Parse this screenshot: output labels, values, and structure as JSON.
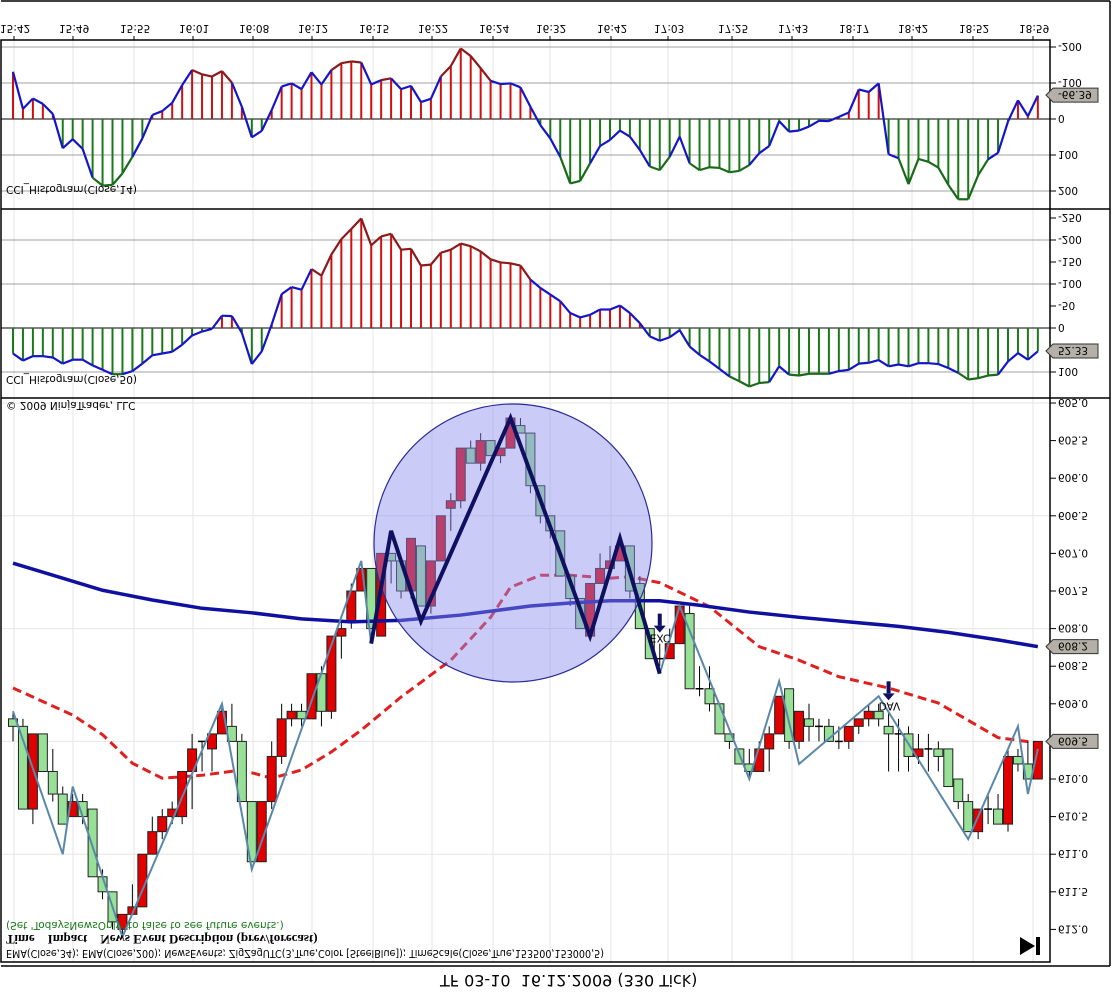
{
  "window": {
    "title": "TF 03-10  16.12.2009 (330 Tick)",
    "copyright": "© 2009 NinjaTrader, LLC",
    "go_to_end_icon": "skip-to-end-icon"
  },
  "time_axis": {
    "labels": [
      "15:42",
      "15:49",
      "15:55",
      "16:01",
      "16:08",
      "16:12",
      "16:15",
      "16:22",
      "16:24",
      "16:32",
      "16:42",
      "17:03",
      "17:25",
      "17:43",
      "18:17",
      "18:42",
      "18:52",
      "18:59"
    ]
  },
  "panels": {
    "cci14": {
      "label": "CCI_Histogram(Close,14)",
      "axis_labels": [
        "-200",
        "-100",
        "0",
        "100",
        "200"
      ],
      "current_value": "-66.39"
    },
    "cci50": {
      "label": "CCI_Histogram(Close,50)",
      "axis_labels": [
        "-250",
        "-200",
        "-150",
        "-100",
        "-50",
        "0",
        "100"
      ],
      "current_value": "52.33"
    },
    "price": {
      "axis_labels": [
        "605.0",
        "605.5",
        "606.0",
        "606.5",
        "607.0",
        "607.5",
        "608.0",
        "608.5",
        "609.0",
        "609.5",
        "610.0",
        "610.5",
        "611.0",
        "611.5",
        "612.0"
      ],
      "ema200_value": "608.2",
      "last_price": "609.5"
    }
  },
  "news": {
    "hint": "(Set 'TodaysNewsOnly' to false to see future events.)",
    "header": "Time    Impact    News Event Description (prev/forecast)",
    "markers": [
      {
        "label": "EXC",
        "bar": 65
      },
      {
        "label": "DAV",
        "bar": 88
      }
    ]
  },
  "indicators_text": "EMA(Close,34); EMA(Close,200); NewsEvents; ZigZagUTC(3,True,Color [SteelBlue]); TimeScale(Close,True,153500,153000,5)",
  "colors": {
    "up_candle": "#98e098",
    "down_candle": "#e00000",
    "ema200": "#1010a0",
    "ema34": "#e02020",
    "zigzag": "#5a88aa",
    "zigzag_pattern": "#101060",
    "cci_line": "#1515c8",
    "cci_positive_bar": "#1a7a1a",
    "cci_negative_bar": "#d01010",
    "highlight_circle": "#8c8cf0"
  },
  "chart_data": [
    {
      "type": "candlestick",
      "title": "",
      "ylim": [
        605.0,
        612.0
      ],
      "y_axis_inverted": true,
      "grid": true,
      "candles_ohlc": [
        [
          609.2,
          609.5,
          609.1,
          609.3
        ],
        [
          609.3,
          610.4,
          609.2,
          610.4
        ],
        [
          610.4,
          610.6,
          609.4,
          609.4
        ],
        [
          609.4,
          609.9,
          609.4,
          609.9
        ],
        [
          609.9,
          610.3,
          609.6,
          610.2
        ],
        [
          610.2,
          610.6,
          610.1,
          610.6
        ],
        [
          610.5,
          610.5,
          610.2,
          610.3
        ],
        [
          610.3,
          610.6,
          610.2,
          610.5
        ],
        [
          610.4,
          611.3,
          610.4,
          611.3
        ],
        [
          611.3,
          611.6,
          611.2,
          611.5
        ],
        [
          611.5,
          612.0,
          611.5,
          611.9
        ],
        [
          612.0,
          612.1,
          611.8,
          611.8
        ],
        [
          611.8,
          611.8,
          611.4,
          611.7
        ],
        [
          611.7,
          611.7,
          611.0,
          611.0
        ],
        [
          611.0,
          611.0,
          610.5,
          610.7
        ],
        [
          610.7,
          610.8,
          610.4,
          610.5
        ],
        [
          610.5,
          610.6,
          610.3,
          610.4
        ],
        [
          610.5,
          610.6,
          609.9,
          609.9
        ],
        [
          609.9,
          610.4,
          609.4,
          609.6
        ],
        [
          609.5,
          609.9,
          609.5,
          609.5
        ],
        [
          609.6,
          609.9,
          609.4,
          609.4
        ],
        [
          609.4,
          609.4,
          609.0,
          609.1
        ],
        [
          609.3,
          609.5,
          609.0,
          609.5
        ],
        [
          609.5,
          610.3,
          609.4,
          610.3
        ],
        [
          610.3,
          611.1,
          610.3,
          611.1
        ],
        [
          611.1,
          611.1,
          610.3,
          610.3
        ],
        [
          610.3,
          610.4,
          609.5,
          609.7
        ],
        [
          609.7,
          609.8,
          609.0,
          609.2
        ],
        [
          609.2,
          609.3,
          609.0,
          609.1
        ],
        [
          609.1,
          609.3,
          609.0,
          609.2
        ],
        [
          609.2,
          609.2,
          608.6,
          608.6
        ],
        [
          608.6,
          609.3,
          608.5,
          609.1
        ],
        [
          609.1,
          609.2,
          608.1,
          608.1
        ],
        [
          608.1,
          608.4,
          607.9,
          608.0
        ],
        [
          607.9,
          608.0,
          607.4,
          607.5
        ],
        [
          607.5,
          607.5,
          607.2,
          607.2
        ],
        [
          607.2,
          608.0,
          607.2,
          608.0
        ],
        [
          608.1,
          608.1,
          607.0,
          607.0
        ],
        [
          607.0,
          607.4,
          607.0,
          607.1
        ],
        [
          607.1,
          607.6,
          607.1,
          607.5
        ],
        [
          607.5,
          607.6,
          606.8,
          606.8
        ],
        [
          606.9,
          607.7,
          606.9,
          607.7
        ],
        [
          607.7,
          607.8,
          607.1,
          607.1
        ],
        [
          607.1,
          607.1,
          606.5,
          606.5
        ],
        [
          606.4,
          606.7,
          606.2,
          606.3
        ],
        [
          606.3,
          606.4,
          605.6,
          605.6
        ],
        [
          605.6,
          605.8,
          605.5,
          605.8
        ],
        [
          605.8,
          605.9,
          605.4,
          605.5
        ],
        [
          605.5,
          605.7,
          605.5,
          605.7
        ],
        [
          605.7,
          605.8,
          605.6,
          605.6
        ],
        [
          605.6,
          605.6,
          605.2,
          605.2
        ],
        [
          605.3,
          605.4,
          605.2,
          605.4
        ],
        [
          605.4,
          606.2,
          605.4,
          606.1
        ],
        [
          606.1,
          606.6,
          606.1,
          606.5
        ],
        [
          606.5,
          606.8,
          606.5,
          606.7
        ],
        [
          606.7,
          607.3,
          606.7,
          607.3
        ],
        [
          607.3,
          607.7,
          607.3,
          607.6
        ],
        [
          607.6,
          608.0,
          607.6,
          608.0
        ],
        [
          608.1,
          608.1,
          607.4,
          607.4
        ],
        [
          607.4,
          607.4,
          607.0,
          607.2
        ],
        [
          607.2,
          607.2,
          606.9,
          607.1
        ],
        [
          607.1,
          607.1,
          606.9,
          606.9
        ],
        [
          606.9,
          607.6,
          606.9,
          607.5
        ],
        [
          607.4,
          608.0,
          607.3,
          608.0
        ],
        [
          608.0,
          608.4,
          608.0,
          608.4
        ],
        [
          608.4,
          608.5,
          608.2,
          608.4
        ],
        [
          608.4,
          608.4,
          608.0,
          608.2
        ],
        [
          608.2,
          608.2,
          607.7,
          607.7
        ],
        [
          607.8,
          608.8,
          607.7,
          608.8
        ],
        [
          608.8,
          608.9,
          608.5,
          608.8
        ],
        [
          608.8,
          609.1,
          608.5,
          609.0
        ],
        [
          609.0,
          609.4,
          609.0,
          609.4
        ],
        [
          609.4,
          609.6,
          609.4,
          609.5
        ],
        [
          609.6,
          609.8,
          609.6,
          609.8
        ],
        [
          609.8,
          610.0,
          609.6,
          609.9
        ],
        [
          609.9,
          609.9,
          609.5,
          609.6
        ],
        [
          609.6,
          609.9,
          609.3,
          609.4
        ],
        [
          609.4,
          609.4,
          608.9,
          608.9
        ],
        [
          608.8,
          609.6,
          608.8,
          609.5
        ],
        [
          609.5,
          609.6,
          609.1,
          609.1
        ],
        [
          609.2,
          609.5,
          609.0,
          609.3
        ],
        [
          609.3,
          609.5,
          609.2,
          609.3
        ],
        [
          609.3,
          609.5,
          609.2,
          609.5
        ],
        [
          609.5,
          609.6,
          609.3,
          609.5
        ],
        [
          609.5,
          609.6,
          609.3,
          609.3
        ],
        [
          609.3,
          609.4,
          609.2,
          609.2
        ],
        [
          609.2,
          609.3,
          609.0,
          609.1
        ],
        [
          609.1,
          609.3,
          609.0,
          609.2
        ],
        [
          609.3,
          609.9,
          609.1,
          609.4
        ],
        [
          609.4,
          609.9,
          609.2,
          609.4
        ],
        [
          609.4,
          609.9,
          609.3,
          609.7
        ],
        [
          609.7,
          609.8,
          609.4,
          609.6
        ],
        [
          609.6,
          609.9,
          609.4,
          609.6
        ],
        [
          609.6,
          609.9,
          609.5,
          609.7
        ],
        [
          609.6,
          610.1,
          609.6,
          610.1
        ],
        [
          610.0,
          610.4,
          610.0,
          610.3
        ],
        [
          610.3,
          610.7,
          610.2,
          610.7
        ],
        [
          610.7,
          610.8,
          610.4,
          610.4
        ],
        [
          610.4,
          610.6,
          610.2,
          610.4
        ],
        [
          610.4,
          610.6,
          610.2,
          610.6
        ],
        [
          610.6,
          610.7,
          609.6,
          609.7
        ],
        [
          609.7,
          609.9,
          609.6,
          609.8
        ],
        [
          609.8,
          610.0,
          609.5,
          610.0
        ],
        [
          610.0,
          610.0,
          609.5,
          609.5
        ]
      ],
      "ema200": [
        [
          0,
          607.13
        ],
        [
          4,
          607.29
        ],
        [
          9,
          607.49
        ],
        [
          14,
          607.62
        ],
        [
          19,
          607.73
        ],
        [
          24,
          607.79
        ],
        [
          29,
          607.87
        ],
        [
          34,
          607.91
        ],
        [
          39,
          607.89
        ],
        [
          45,
          607.82
        ],
        [
          52,
          607.7
        ],
        [
          56,
          607.66
        ],
        [
          60,
          607.63
        ],
        [
          65,
          607.63
        ],
        [
          69,
          607.69
        ],
        [
          74,
          607.78
        ],
        [
          79,
          607.85
        ],
        [
          84,
          607.91
        ],
        [
          89,
          607.97
        ],
        [
          94,
          608.05
        ],
        [
          99,
          608.15
        ],
        [
          103,
          608.24
        ]
      ],
      "ema34": [
        [
          0,
          608.79
        ],
        [
          2,
          608.91
        ],
        [
          6,
          609.15
        ],
        [
          9,
          609.41
        ],
        [
          12,
          609.79
        ],
        [
          15,
          609.99
        ],
        [
          19,
          609.95
        ],
        [
          23,
          609.88
        ],
        [
          26,
          609.99
        ],
        [
          29,
          609.88
        ],
        [
          32,
          609.64
        ],
        [
          35,
          609.35
        ],
        [
          39,
          608.91
        ],
        [
          44,
          608.42
        ],
        [
          48,
          607.85
        ],
        [
          50,
          607.45
        ],
        [
          53,
          607.29
        ],
        [
          56,
          607.29
        ],
        [
          60,
          607.33
        ],
        [
          62,
          607.31
        ],
        [
          65,
          607.39
        ],
        [
          68,
          607.58
        ],
        [
          70,
          607.71
        ],
        [
          75,
          608.24
        ],
        [
          79,
          608.42
        ],
        [
          83,
          608.64
        ],
        [
          88,
          608.79
        ],
        [
          93,
          608.99
        ],
        [
          96,
          609.22
        ],
        [
          99,
          609.45
        ],
        [
          103,
          609.52
        ]
      ],
      "zigzag": [
        [
          0,
          609.1
        ],
        [
          5,
          611.0
        ],
        [
          6,
          610.1
        ],
        [
          11,
          612.1
        ],
        [
          21,
          609.0
        ],
        [
          24,
          611.2
        ],
        [
          35,
          607.1
        ],
        [
          36,
          608.2
        ]
      ],
      "zigzag_pattern": [
        [
          36,
          608.2
        ],
        [
          38,
          606.7
        ],
        [
          41,
          607.9
        ],
        [
          50,
          605.2
        ],
        [
          58,
          608.1
        ],
        [
          61,
          606.8
        ],
        [
          65,
          608.6
        ]
      ],
      "zigzag_after": [
        [
          65,
          608.6
        ],
        [
          67,
          607.7
        ],
        [
          74,
          610.0
        ],
        [
          77,
          608.7
        ],
        [
          79,
          609.8
        ],
        [
          87,
          608.9
        ],
        [
          96,
          610.8
        ],
        [
          101,
          609.3
        ],
        [
          102,
          610.2
        ],
        [
          103,
          609.6
        ]
      ]
    },
    {
      "type": "bar",
      "name": "CCI_Histogram(Close,14)",
      "ylim": [
        -200,
        200
      ],
      "values": [
        -131,
        -28,
        -57,
        -42,
        -14,
        81,
        56,
        83,
        163,
        185,
        183,
        151,
        105,
        54,
        -11,
        -22,
        -45,
        -94,
        -136,
        -124,
        -118,
        -133,
        -101,
        -34,
        51,
        33,
        -25,
        -90,
        -99,
        -83,
        -130,
        -96,
        -136,
        -155,
        -160,
        -157,
        -96,
        -108,
        -113,
        -83,
        -92,
        -47,
        -56,
        -118,
        -147,
        -196,
        -175,
        -141,
        -106,
        -97,
        -99,
        -88,
        -34,
        17,
        54,
        105,
        179,
        172,
        123,
        75,
        58,
        32,
        49,
        86,
        132,
        142,
        105,
        49,
        123,
        142,
        134,
        136,
        148,
        144,
        128,
        95,
        75,
        6,
        35,
        32,
        21,
        5,
        6,
        -6,
        -18,
        -82,
        -75,
        -99,
        98,
        109,
        181,
        111,
        119,
        135,
        183,
        223,
        223,
        156,
        112,
        94,
        7,
        -52,
        -8,
        -65
      ]
    },
    {
      "type": "bar",
      "name": "CCI_Histogram(Close,50)",
      "ylim": [
        -250,
        100
      ],
      "values": [
        58,
        74,
        64,
        64,
        67,
        81,
        72,
        72,
        85,
        95,
        105,
        105,
        98,
        81,
        62,
        58,
        54,
        38,
        17,
        8,
        2,
        -28,
        -27,
        11,
        82,
        53,
        -8,
        -77,
        -93,
        -87,
        -134,
        -119,
        -167,
        -202,
        -225,
        -249,
        -188,
        -208,
        -214,
        -178,
        -180,
        -142,
        -144,
        -171,
        -178,
        -192,
        -186,
        -174,
        -156,
        -149,
        -147,
        -142,
        -110,
        -91,
        -76,
        -61,
        -34,
        -24,
        -30,
        -42,
        -42,
        -51,
        -34,
        -11,
        19,
        29,
        21,
        5,
        42,
        61,
        76,
        93,
        110,
        121,
        133,
        125,
        123,
        87,
        106,
        108,
        104,
        104,
        104,
        98,
        95,
        81,
        79,
        73,
        87,
        83,
        87,
        80,
        80,
        82,
        91,
        102,
        117,
        114,
        108,
        106,
        76,
        57,
        72,
        53
      ]
    }
  ]
}
